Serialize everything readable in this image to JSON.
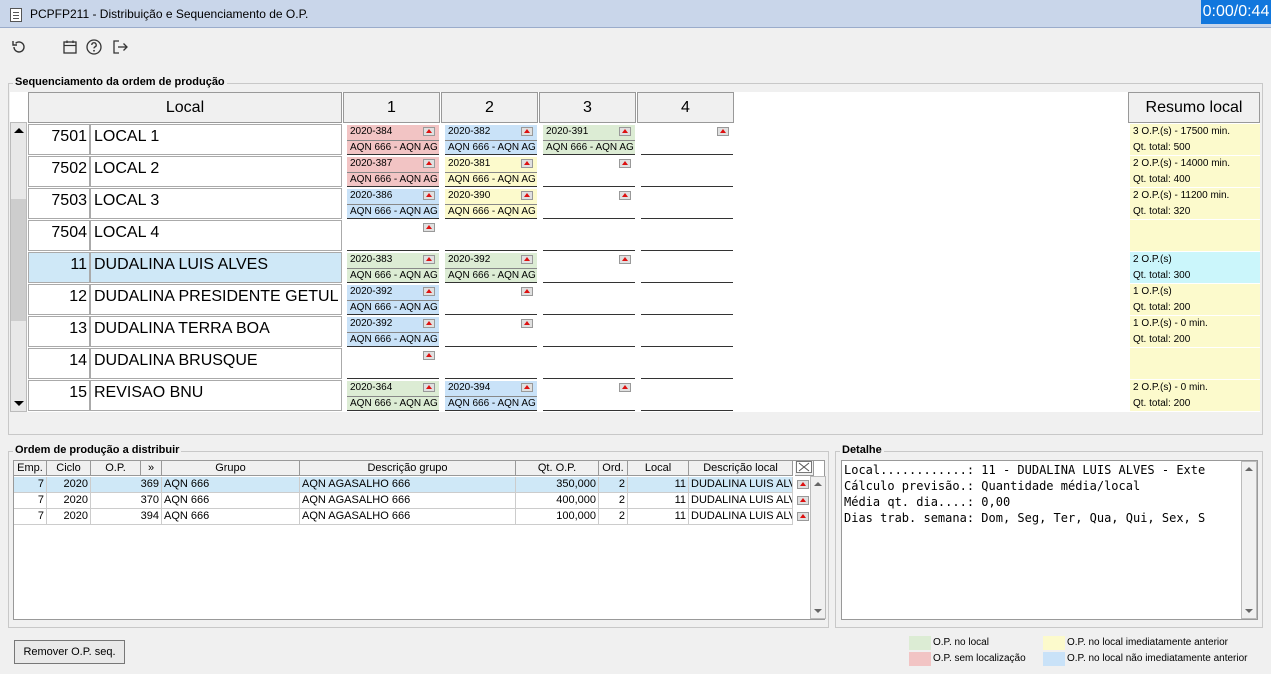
{
  "window": {
    "title": "PCPFP211 - Distribuição e Sequenciamento de O.P.",
    "timer": "0:00/0:44"
  },
  "colors": {
    "green": "#dcecd4",
    "red": "#f2c4c4",
    "yellow": "#fcfacc",
    "blue": "#c9e2f8",
    "cyan": "#cbf6fb"
  },
  "seq": {
    "group_label": "Sequenciamento da ordem de produção",
    "header_local": "Local",
    "columns": [
      "1",
      "2",
      "3",
      "4"
    ],
    "header_resumo": "Resumo local",
    "rows": [
      {
        "code": "7501",
        "name": "LOCAL 1",
        "cells": [
          {
            "op": "2020-384",
            "desc": "AQN 666 - AQN AG",
            "color": "red"
          },
          {
            "op": "2020-382",
            "desc": "AQN 666 - AQN AG",
            "color": "blue"
          },
          {
            "op": "2020-391",
            "desc": "AQN 666 - AQN AG",
            "color": "green"
          },
          {
            "op": "",
            "desc": "",
            "color": ""
          }
        ],
        "sum1": "3 O.P.(s) - 17500 min.",
        "sum2": "Qt. total: 500"
      },
      {
        "code": "7502",
        "name": "LOCAL 2",
        "cells": [
          {
            "op": "2020-387",
            "desc": "AQN 666 - AQN AG",
            "color": "red"
          },
          {
            "op": "2020-381",
            "desc": "AQN 666 - AQN AG",
            "color": "yellow"
          },
          {
            "op": "",
            "desc": "",
            "color": ""
          },
          {
            "op": "",
            "desc": "",
            "color": ""
          }
        ],
        "sum1": "2 O.P.(s) - 14000 min.",
        "sum2": "Qt. total: 400"
      },
      {
        "code": "7503",
        "name": "LOCAL 3",
        "cells": [
          {
            "op": "2020-386",
            "desc": "AQN 666 - AQN AG",
            "color": "blue"
          },
          {
            "op": "2020-390",
            "desc": "AQN 666 - AQN AG",
            "color": "yellow"
          },
          {
            "op": "",
            "desc": "",
            "color": ""
          },
          {
            "op": "",
            "desc": "",
            "color": ""
          }
        ],
        "sum1": "2 O.P.(s) - 11200 min.",
        "sum2": "Qt. total: 320"
      },
      {
        "code": "7504",
        "name": "LOCAL 4",
        "cells": [
          {
            "op": "",
            "desc": "",
            "color": ""
          },
          {
            "op": "",
            "desc": "",
            "color": ""
          },
          {
            "op": "",
            "desc": "",
            "color": ""
          },
          {
            "op": "",
            "desc": "",
            "color": ""
          }
        ],
        "sum1": "",
        "sum2": ""
      },
      {
        "code": "11",
        "name": "DUDALINA LUIS ALVES",
        "cells": [
          {
            "op": "2020-383",
            "desc": "AQN 666 - AQN AG",
            "color": "green"
          },
          {
            "op": "2020-392",
            "desc": "AQN 666 - AQN AG",
            "color": "green"
          },
          {
            "op": "",
            "desc": "",
            "color": ""
          },
          {
            "op": "",
            "desc": "",
            "color": ""
          }
        ],
        "sum1": "2 O.P.(s)",
        "sum2": "Qt. total: 300"
      },
      {
        "code": "12",
        "name": "DUDALINA PRESIDENTE GETUL",
        "cells": [
          {
            "op": "2020-392",
            "desc": "AQN 666 - AQN AG",
            "color": "blue"
          },
          {
            "op": "",
            "desc": "",
            "color": ""
          },
          {
            "op": "",
            "desc": "",
            "color": ""
          },
          {
            "op": "",
            "desc": "",
            "color": ""
          }
        ],
        "sum1": "1 O.P.(s)",
        "sum2": "Qt. total: 200"
      },
      {
        "code": "13",
        "name": "DUDALINA TERRA BOA",
        "cells": [
          {
            "op": "2020-392",
            "desc": "AQN 666 - AQN AG",
            "color": "blue"
          },
          {
            "op": "",
            "desc": "",
            "color": ""
          },
          {
            "op": "",
            "desc": "",
            "color": ""
          },
          {
            "op": "",
            "desc": "",
            "color": ""
          }
        ],
        "sum1": "1 O.P.(s) - 0 min.",
        "sum2": "Qt. total: 200"
      },
      {
        "code": "14",
        "name": "DUDALINA BRUSQUE",
        "cells": [
          {
            "op": "",
            "desc": "",
            "color": ""
          },
          {
            "op": "",
            "desc": "",
            "color": ""
          },
          {
            "op": "",
            "desc": "",
            "color": ""
          },
          {
            "op": "",
            "desc": "",
            "color": ""
          }
        ],
        "sum1": "",
        "sum2": ""
      },
      {
        "code": "15",
        "name": "REVISAO BNU",
        "cells": [
          {
            "op": "2020-364",
            "desc": "AQN 666 - AQN AG",
            "color": "green"
          },
          {
            "op": "2020-394",
            "desc": "AQN 666 - AQN AG",
            "color": "blue"
          },
          {
            "op": "",
            "desc": "",
            "color": ""
          },
          {
            "op": "",
            "desc": "",
            "color": ""
          }
        ],
        "sum1": "2 O.P.(s) - 0 min.",
        "sum2": "Qt. total: 200"
      }
    ]
  },
  "distrib": {
    "group_label": "Ordem de produção a distribuir",
    "headers": [
      "Emp.",
      "Ciclo",
      "O.P.",
      "»",
      "Grupo",
      "Descrição grupo",
      "Qt. O.P.",
      "Ord.",
      "Local",
      "Descrição local"
    ],
    "rows": [
      [
        "7",
        "2020",
        "369",
        "AQN 666",
        "AQN AGASALHO 666",
        "350,000",
        "2",
        "11",
        "DUDALINA LUIS ALVES"
      ],
      [
        "7",
        "2020",
        "370",
        "AQN 666",
        "AQN AGASALHO 666",
        "400,000",
        "2",
        "11",
        "DUDALINA LUIS ALVES"
      ],
      [
        "7",
        "2020",
        "394",
        "AQN 666",
        "AQN AGASALHO 666",
        "100,000",
        "2",
        "11",
        "DUDALINA LUIS ALVES"
      ]
    ]
  },
  "detalhe": {
    "group_label": "Detalhe",
    "lines": [
      "Local............: 11 - DUDALINA LUIS ALVES - Exte",
      "Cálculo previsão.: Quantidade média/local",
      "Média qt. dia....: 0,00",
      "Dias trab. semana: Dom, Seg, Ter, Qua, Qui, Sex, S"
    ]
  },
  "legend": {
    "no_local": "O.P. no local",
    "sem_loc": "O.P. sem localização",
    "imediato": "O.P. no local imediatamente anterior",
    "nao_imediato": "O.P. no local não imediatamente anterior"
  },
  "buttons": {
    "remover": "Remover O.P. seq."
  }
}
